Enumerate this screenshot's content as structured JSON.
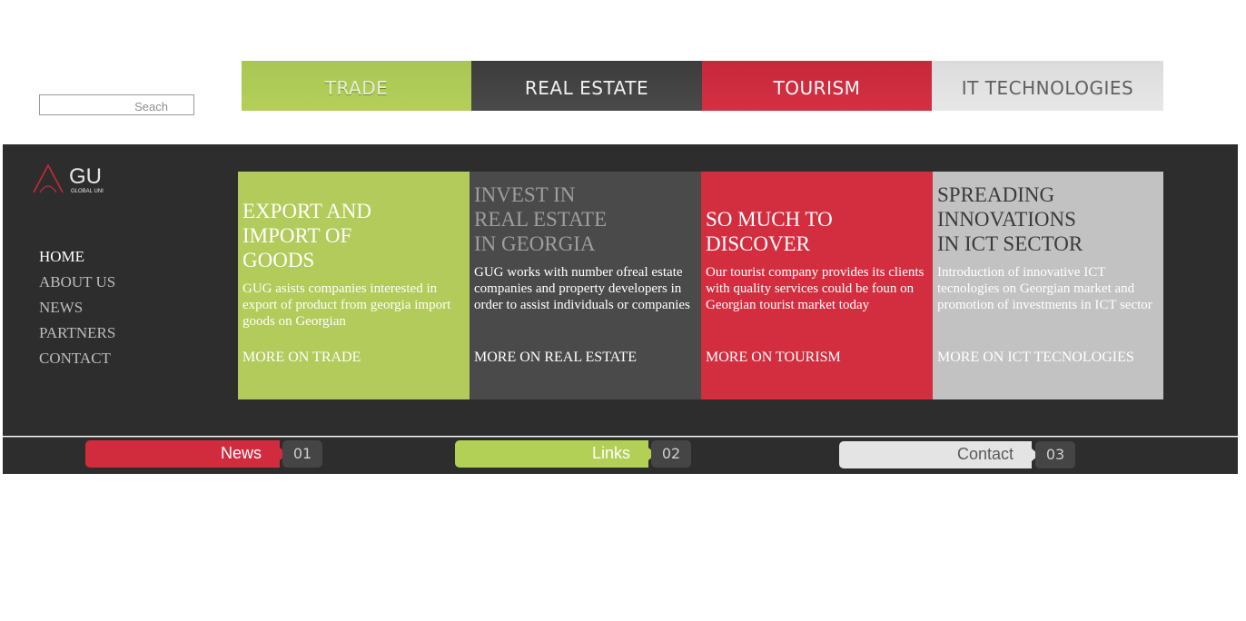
{
  "search": {
    "placeholder": "Seach"
  },
  "tabs": [
    {
      "label": "TRADE"
    },
    {
      "label": "REAL ESTATE"
    },
    {
      "label": "TOURISM"
    },
    {
      "label": "IT TECHNOLOGIES"
    }
  ],
  "logo": {
    "mark": "GU",
    "subtitle": "GLOBAL UNI"
  },
  "nav": [
    "HOME",
    "ABOUT US",
    "NEWS",
    "PARTNERS",
    "CONTACT"
  ],
  "panels": [
    {
      "title_lines": [
        "EXPORT AND",
        "IMPORT OF",
        "GOODS"
      ],
      "text": "GUG asists companies interested in export of product from georgia import goods on Georgian",
      "link": "MORE ON TRADE"
    },
    {
      "title_lines": [
        "INVEST IN",
        "REAL ESTATE",
        "IN GEORGIA"
      ],
      "text": "GUG works with number ofreal estate companies and property developers in order to assist individuals or companies",
      "link": "MORE ON REAL ESTATE"
    },
    {
      "title_lines": [
        "SO MUCH TO",
        "DISCOVER"
      ],
      "text": "Our tourist company provides its clients with quality services could be foun on Georgian tourist market today",
      "link": "MORE ON TOURISM"
    },
    {
      "title_lines": [
        "SPREADING",
        "INNOVATIONS",
        "IN ICT SECTOR"
      ],
      "text": "Introduction of innovative ICT tecnologies on Georgian market and promotion of investments in ICT sector",
      "link": "MORE ON ICT TECNOLOGIES"
    }
  ],
  "bottom": [
    {
      "label": "News",
      "number": "01"
    },
    {
      "label": "Links",
      "number": "02"
    },
    {
      "label": "Contact",
      "number": "03"
    }
  ]
}
